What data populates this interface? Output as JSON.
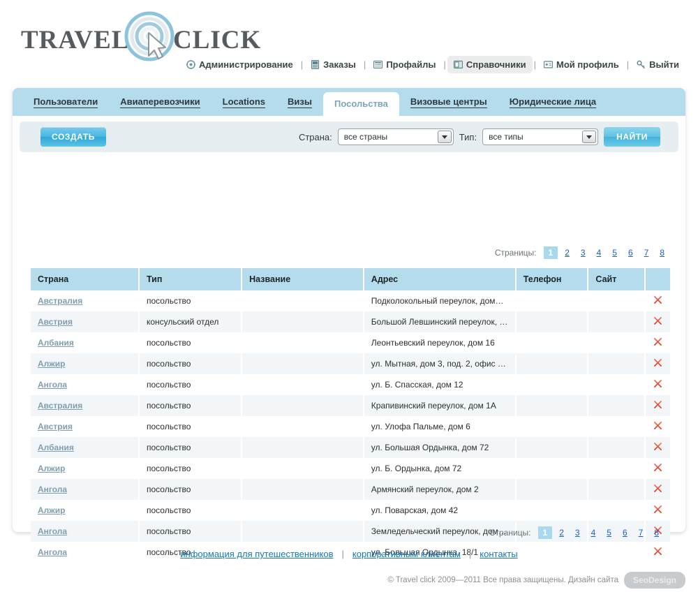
{
  "brand": {
    "word1": "TRAVEL",
    "word2": "CLICK",
    "logo_icon": "swirl-cursor-logo"
  },
  "topnav": {
    "items": [
      {
        "label": "Администрирование",
        "icon": "gear-icon",
        "active": false
      },
      {
        "label": "Заказы",
        "icon": "orders-icon",
        "active": false
      },
      {
        "label": "Профайлы",
        "icon": "profiles-icon",
        "active": false
      },
      {
        "label": "Справочники",
        "icon": "catalogs-icon",
        "active": true
      },
      {
        "label": "Мой профиль",
        "icon": "user-card-icon",
        "active": false
      },
      {
        "label": "Выйти",
        "icon": "key-icon",
        "active": false
      }
    ],
    "separator": "|"
  },
  "tabs": [
    {
      "label": "Пользователи",
      "active": false
    },
    {
      "label": "Авиаперевозчики",
      "active": false
    },
    {
      "label": "Locations",
      "active": false
    },
    {
      "label": "Визы",
      "active": false
    },
    {
      "label": "Посольства",
      "active": true
    },
    {
      "label": "Визовые центры",
      "active": false
    },
    {
      "label": "Юридические лица",
      "active": false
    }
  ],
  "toolbar": {
    "create_label": "СОЗДАТЬ",
    "country_label": "Страна:",
    "country_value": "все страны",
    "type_label": "Тип:",
    "type_value": "все типы",
    "find_label": "НАЙТИ"
  },
  "pagination": {
    "label": "Страницы:",
    "current": "1",
    "pages": [
      "2",
      "3",
      "4",
      "5",
      "6",
      "7",
      "8"
    ]
  },
  "table": {
    "headers": [
      "Страна",
      "Тип",
      "Название",
      "Адрес",
      "Телефон",
      "Сайт",
      ""
    ],
    "rows": [
      {
        "country": "Австралия",
        "type": "посольство",
        "name": "",
        "address": "Подколокольный переулок, дом…",
        "phone": "",
        "site": "",
        "delete_icon": "delete-x-icon"
      },
      {
        "country": "Австрия",
        "type": "консульский отдел",
        "name": "",
        "address": "Большой Левшинский переулок, …",
        "phone": "",
        "site": "",
        "delete_icon": "delete-x-icon"
      },
      {
        "country": "Албания",
        "type": "посольство",
        "name": "",
        "address": "Леонтьевский переулок, дом 16",
        "phone": "",
        "site": "",
        "delete_icon": "delete-x-icon"
      },
      {
        "country": "Алжир",
        "type": "посольство",
        "name": "",
        "address": "ул. Мытная, дом 3, под. 2, офис …",
        "phone": "",
        "site": "",
        "delete_icon": "delete-x-icon"
      },
      {
        "country": "Ангола",
        "type": "посольство",
        "name": "",
        "address": "ул. Б. Спасская, дом 12",
        "phone": "",
        "site": "",
        "delete_icon": "delete-x-icon"
      },
      {
        "country": "Австралия",
        "type": "посольство",
        "name": "",
        "address": "Крапивинский переулок, дом 1А",
        "phone": "",
        "site": "",
        "delete_icon": "delete-x-icon"
      },
      {
        "country": "Австрия",
        "type": "посольство",
        "name": "",
        "address": "ул. Улофа Пальме, дом 6",
        "phone": "",
        "site": "",
        "delete_icon": "delete-x-icon"
      },
      {
        "country": "Албания",
        "type": "посольство",
        "name": "",
        "address": "ул. Большая Ордынка, дом 72",
        "phone": "",
        "site": "",
        "delete_icon": "delete-x-icon"
      },
      {
        "country": "Алжир",
        "type": "посольство",
        "name": "",
        "address": "ул. Б. Ордынка, дом 72",
        "phone": "",
        "site": "",
        "delete_icon": "delete-x-icon"
      },
      {
        "country": "Ангола",
        "type": "посольство",
        "name": "",
        "address": "Армянский переулок, дом 2",
        "phone": "",
        "site": "",
        "delete_icon": "delete-x-icon"
      },
      {
        "country": "Алжир",
        "type": "посольство",
        "name": "",
        "address": "ул. Поварская, дом 42",
        "phone": "",
        "site": "",
        "delete_icon": "delete-x-icon"
      },
      {
        "country": "Ангола",
        "type": "посольство",
        "name": "",
        "address": "Земледельческий переулок, дом…",
        "phone": "",
        "site": "",
        "delete_icon": "delete-x-icon"
      },
      {
        "country": "Ангола",
        "type": "посольство",
        "name": "",
        "address": "ул. Большая Ордынка, 18/1",
        "phone": "",
        "site": "",
        "delete_icon": "delete-x-icon"
      }
    ]
  },
  "footer": {
    "links": [
      "информация для путешественников",
      "корпоративным клиентам",
      "контакты"
    ],
    "separator": "|",
    "copyright": "© Travel click  2009—2011  Все права защищены.   Дизайн сайта",
    "design_badge": "SeoDesign"
  },
  "colors": {
    "tabbar": "#b5dced",
    "accent_button": "#46b7e2",
    "link": "#1a5fc4",
    "country_link": "#7f9fb0",
    "delete": "#e8472c",
    "filter_bg": "#e6eef2",
    "row_alt": "#f2f6f8"
  }
}
